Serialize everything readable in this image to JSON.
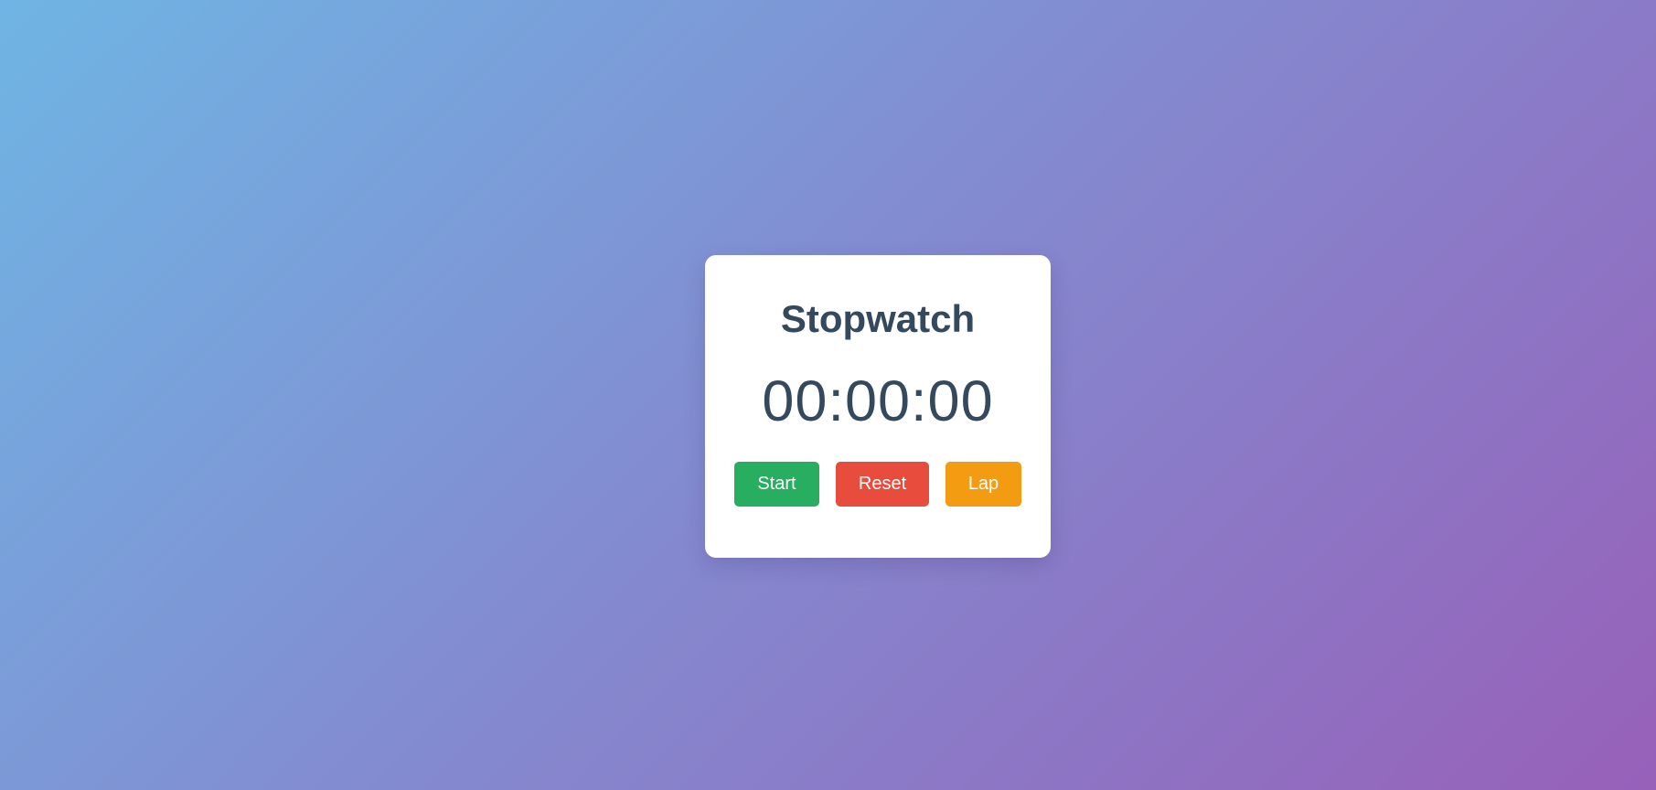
{
  "stopwatch": {
    "title": "Stopwatch",
    "time": "00:00:00",
    "buttons": {
      "start": "Start",
      "reset": "Reset",
      "lap": "Lap"
    }
  },
  "colors": {
    "text": "#34495e",
    "start": "#27ae60",
    "reset": "#e74c3c",
    "lap": "#f39c12",
    "card": "#ffffff",
    "background_from": "#6fb5e4",
    "background_to": "#9760b9"
  }
}
